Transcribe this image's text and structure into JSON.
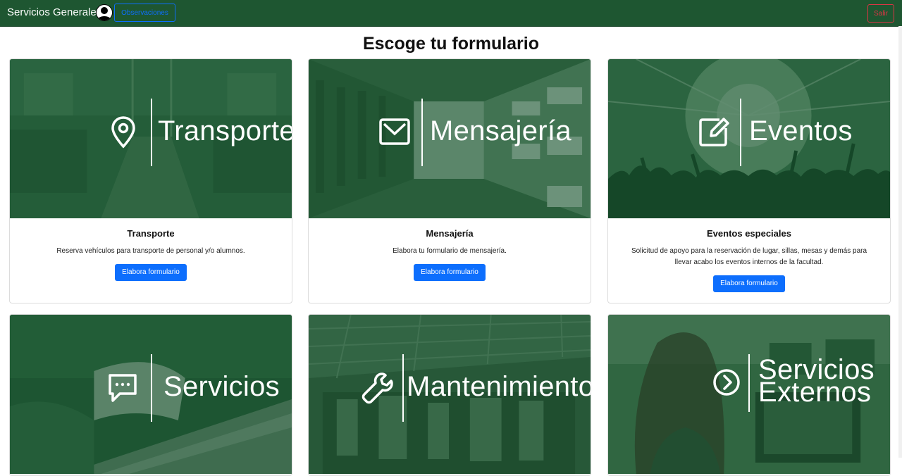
{
  "navbar": {
    "brand": "Servicios Generales",
    "observaciones_label": "Observaciones",
    "salir_label": "Salir"
  },
  "page": {
    "title": "Escoge tu formulario"
  },
  "cards": [
    {
      "overlay_text": "Transporte",
      "icon": "location-pin-icon",
      "title": "Transporte",
      "text": "Reserva vehículos para transporte de personal y/o alumnos.",
      "button": "Elabora formulario"
    },
    {
      "overlay_text": "Mensajería",
      "icon": "envelope-icon",
      "title": "Mensajería",
      "text": "Elabora tu formulario de mensajería.",
      "button": "Elabora formulario"
    },
    {
      "overlay_text": "Eventos",
      "icon": "edit-square-icon",
      "title": "Eventos especiales",
      "text": "Solicitud de apoyo para la reservación de lugar, sillas, mesas y demás para llevar acabo los eventos internos de la facultad.",
      "button": "Elabora formulario"
    },
    {
      "overlay_text": "Servicios",
      "icon": "chat-bubble-icon"
    },
    {
      "overlay_text": "Mantenimiento",
      "icon": "wrench-icon"
    },
    {
      "overlay_text_line1": "Servicios",
      "overlay_text_line2": "Externos",
      "icon": "arrow-circle-icon"
    }
  ],
  "colors": {
    "navbar": "#1e5631",
    "overlay": "#1b5230",
    "primary": "#0d6efd",
    "danger": "#dc3545"
  }
}
